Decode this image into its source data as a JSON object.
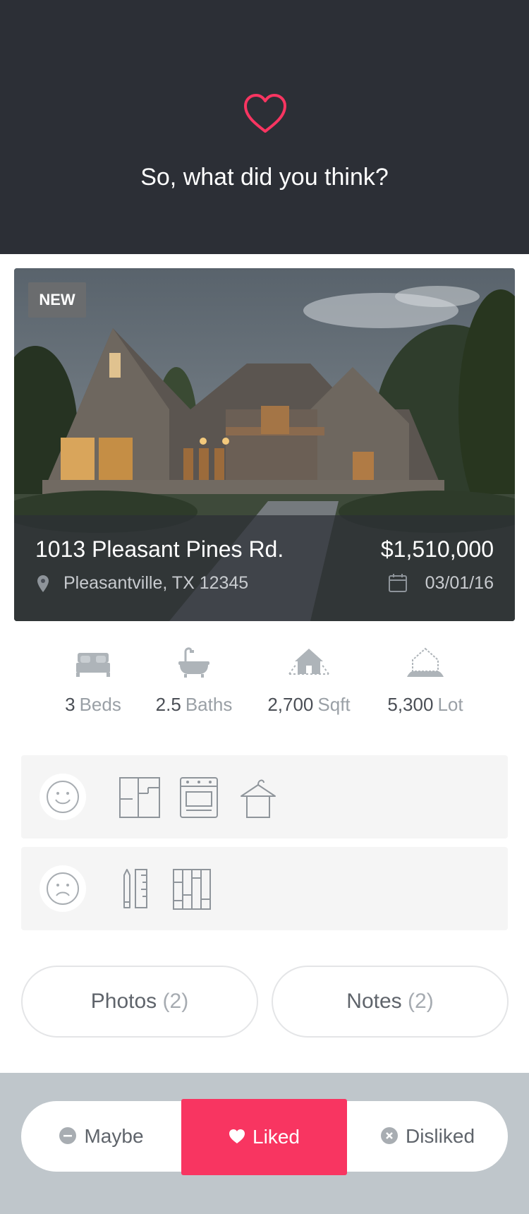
{
  "header": {
    "prompt": "So, what did you think?",
    "icon": "heart-outline-icon",
    "accent_color": "#f83561",
    "background_color": "#2c2f36"
  },
  "listing": {
    "badge": "NEW",
    "address": "1013 Pleasant Pines Rd.",
    "city": "Pleasantville, TX 12345",
    "price": "$1,510,000",
    "date": "03/01/16"
  },
  "stats": [
    {
      "value": "3",
      "unit": "Beds",
      "icon": "bed-icon"
    },
    {
      "value": "2.5",
      "unit": "Baths",
      "icon": "bathtub-icon"
    },
    {
      "value": "2,700",
      "unit": "Sqft",
      "icon": "house-sqft-icon"
    },
    {
      "value": "5,300",
      "unit": "Lot",
      "icon": "lot-icon"
    }
  ],
  "likes": {
    "mood": "smiley-icon",
    "features": [
      "floor-plan-icon",
      "oven-icon",
      "closet-hanger-icon"
    ]
  },
  "dislikes": {
    "mood": "frown-icon",
    "features": [
      "measure-pencil-ruler-icon",
      "flooring-icon"
    ]
  },
  "actions": {
    "photos_label": "Photos",
    "photos_count": "(2)",
    "notes_label": "Notes",
    "notes_count": "(2)"
  },
  "rating": {
    "maybe": "Maybe",
    "liked": "Liked",
    "disliked": "Disliked",
    "selected": "Liked",
    "selected_color": "#f83561"
  }
}
